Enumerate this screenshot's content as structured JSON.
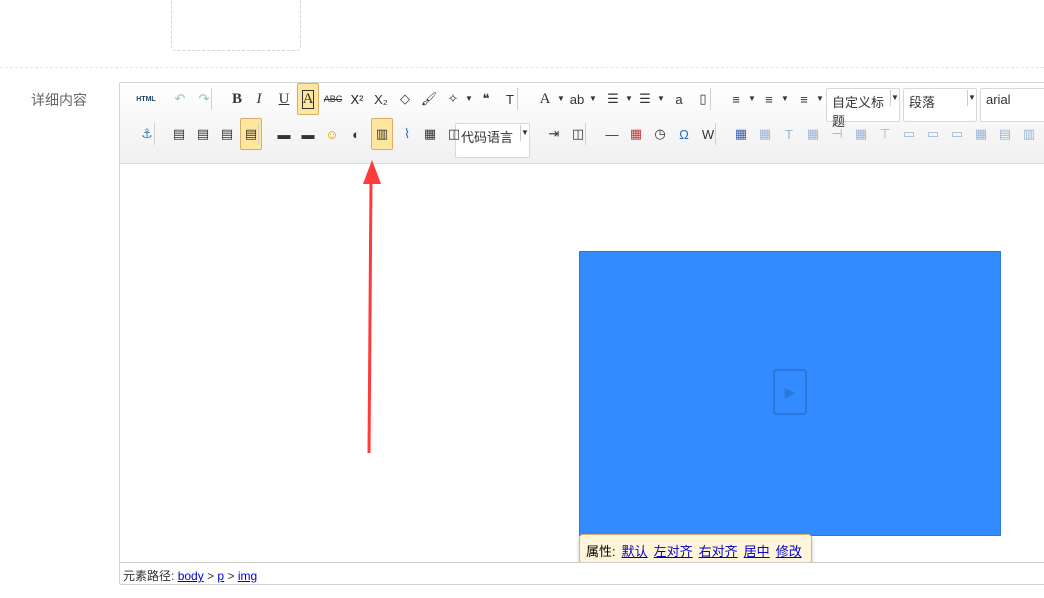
{
  "form": {
    "field_label": "详细内容"
  },
  "toolbar": {
    "row1": [
      "html",
      "undo",
      "redo",
      "|",
      "bold",
      "italic",
      "underline",
      "font-border",
      "strikethrough",
      "superscript",
      "subscript",
      "eraser",
      "format-brush",
      "auto-format",
      "blockquote",
      "paste-plain",
      "|",
      "font-color",
      "highlight",
      "ordered-list",
      "unordered-list",
      "select-all",
      "clear-doc",
      "|",
      "row-spacing-top",
      "row-spacing-bottom",
      "line-height"
    ],
    "row2": [
      "anchor",
      "|",
      "image-left",
      "image-right",
      "image-none",
      "image-center",
      "|",
      "simple-upload",
      "multi-image",
      "emotion",
      "scrawl",
      "insert-video",
      "attachment",
      "map",
      "insert-frame",
      "code-language",
      "page-break",
      "template",
      "|",
      "horizontal-rule",
      "date",
      "time",
      "special-chars",
      "word-image",
      "|",
      "insert-table",
      "delete-table",
      "caption",
      "insert-row",
      "delete-row",
      "insert-col",
      "delete-col",
      "merge-cells",
      "merge-right",
      "merge-down",
      "split-cells",
      "split-rows",
      "split-cols",
      "chart"
    ],
    "glyphs": {
      "html": "HTML",
      "undo": "↶",
      "redo": "↷",
      "bold": "B",
      "italic": "I",
      "underline": "U",
      "font-border": "A",
      "strikethrough": "ABC",
      "superscript": "X²",
      "subscript": "X₂",
      "eraser": "◇",
      "format-brush": "🖌",
      "auto-format": "✧",
      "blockquote": "❝",
      "paste-plain": "T",
      "font-color": "A",
      "highlight": "ab",
      "ordered-list": "☰",
      "unordered-list": "☰",
      "select-all": "a",
      "clear-doc": "▯",
      "row-spacing-top": "≡",
      "row-spacing-bottom": "≡",
      "line-height": "≡",
      "anchor": "⚓",
      "image-left": "▤",
      "image-right": "▤",
      "image-none": "▤",
      "image-center": "▤",
      "simple-upload": "▬",
      "multi-image": "▬",
      "emotion": "☺",
      "scrawl": "◐",
      "insert-video": "▥",
      "attachment": "⌇",
      "map": "▦",
      "insert-frame": "◫",
      "page-break": "⇥",
      "template": "◫",
      "horizontal-rule": "—",
      "date": "▦",
      "time": "◷",
      "special-chars": "Ω",
      "word-image": "W",
      "insert-table": "▦",
      "delete-table": "▦",
      "caption": "T",
      "insert-row": "▦",
      "delete-row": "⊣",
      "insert-col": "▦",
      "delete-col": "⊤",
      "merge-cells": "▭",
      "merge-right": "▭",
      "merge-down": "▭",
      "split-cells": "▦",
      "split-rows": "▤",
      "split-cols": "▥",
      "chart": "▭"
    },
    "selects": {
      "heading": "自定义标题",
      "paragraph": "段落",
      "font_family": "arial",
      "code_language": "代码语言"
    }
  },
  "popup": {
    "label": "属性:",
    "links": [
      "默认",
      "左对齐",
      "右对齐",
      "居中",
      "修改"
    ]
  },
  "status": {
    "label": "元素路径:",
    "path": [
      "body",
      "p",
      "img"
    ],
    "separator": ">"
  },
  "colors": {
    "video_bg": "#338cff",
    "active_bg": "#ffe69f",
    "arrow": "#ff3b3b"
  }
}
